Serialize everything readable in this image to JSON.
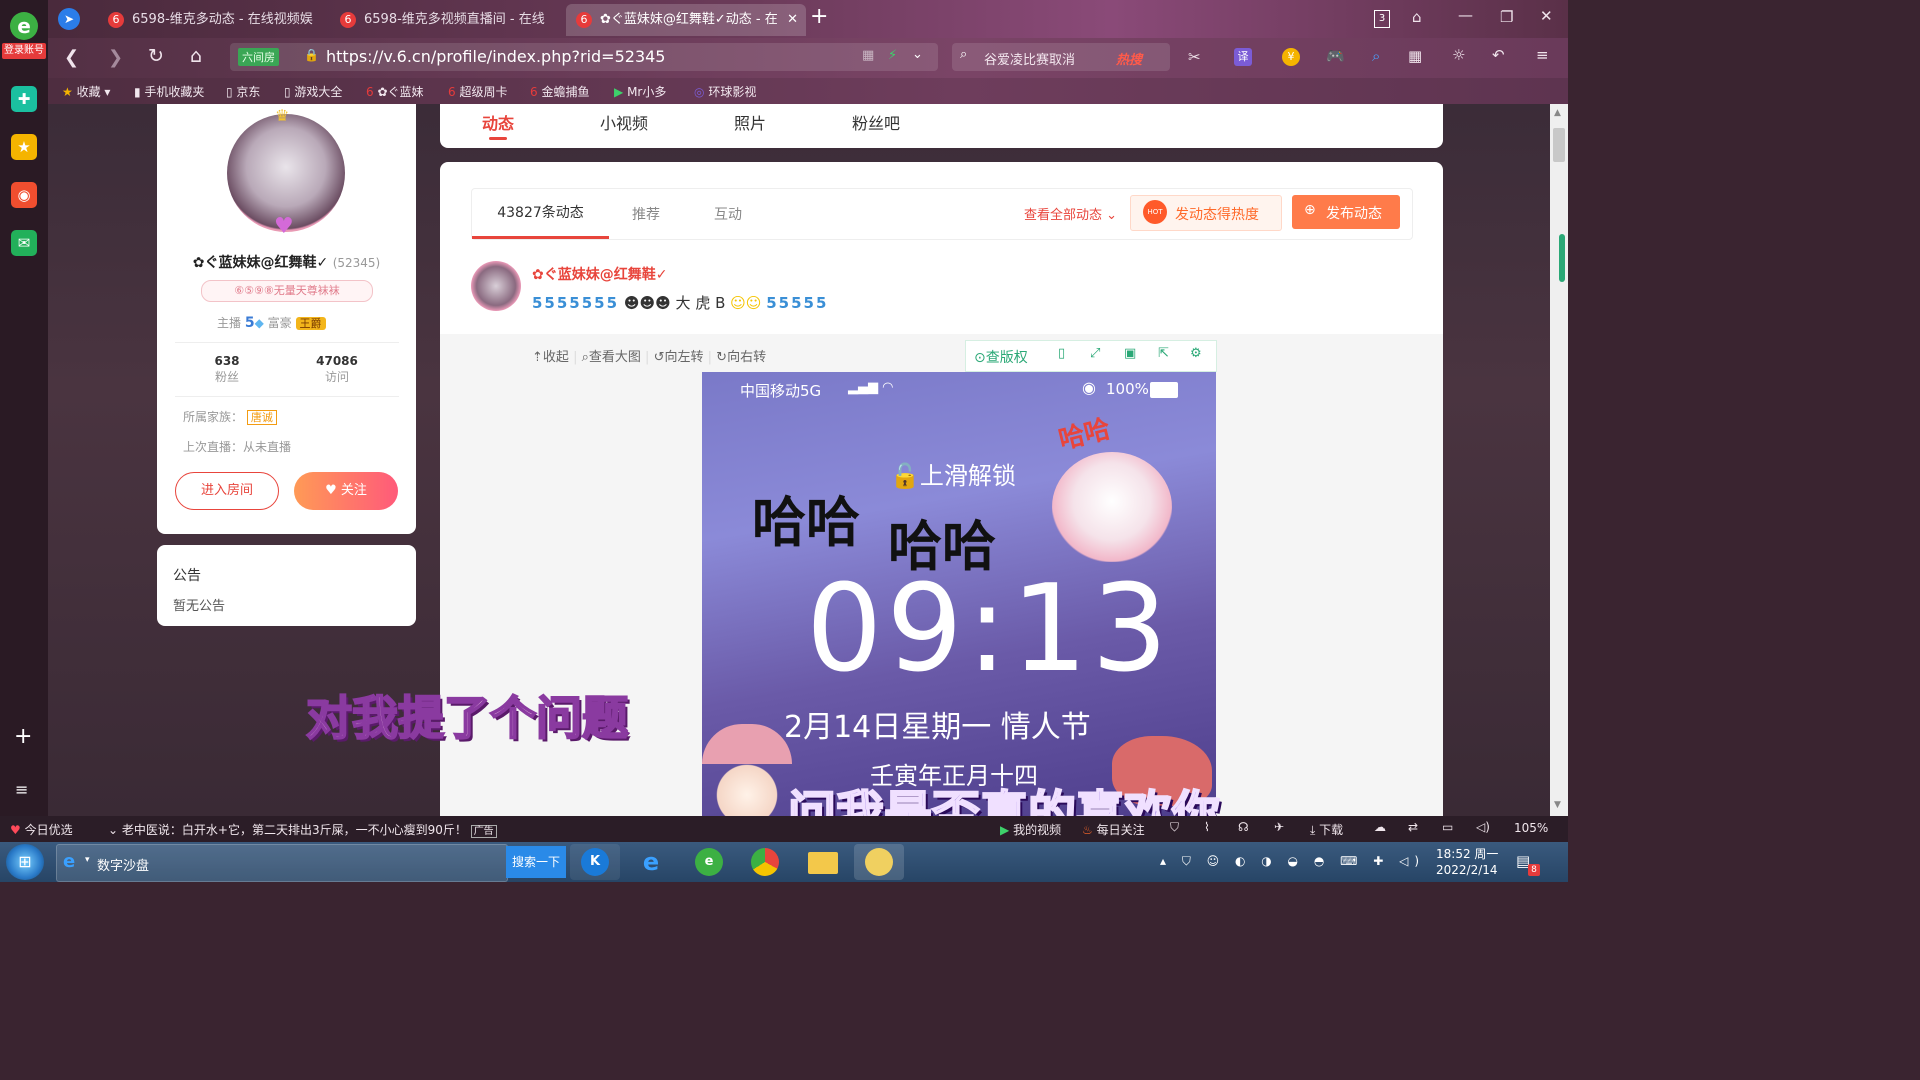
{
  "left_dock": {
    "login_label": "登录账号"
  },
  "tabs": [
    {
      "label": "6598-维克多动态 - 在线视频娱",
      "icon": "6"
    },
    {
      "label": "6598-维克多视频直播间 - 在线",
      "icon": "6"
    },
    {
      "label": "✿ぐ蓝妹妹@红舞鞋✓动态 - 在",
      "icon": "6"
    }
  ],
  "window": {
    "tab_count": "3"
  },
  "address": {
    "safe_label": "六间房",
    "url": "https://v.6.cn/profile/index.php?rid=52345",
    "search_text": "谷爱凌比赛取消",
    "hot_label": "热搜",
    "translate_label": "译"
  },
  "bookmarks": [
    {
      "label": "收藏"
    },
    {
      "label": "手机收藏夹"
    },
    {
      "label": "京东"
    },
    {
      "label": "游戏大全"
    },
    {
      "label": "ぐ蓝妹"
    },
    {
      "label": "超级周卡"
    },
    {
      "label": "金蟾捕鱼"
    },
    {
      "label": "Mr小多"
    },
    {
      "label": "环球影视"
    }
  ],
  "profile": {
    "name": "✿ぐ蓝妹妹@红舞鞋✓",
    "rid": "(52345)",
    "badge_text": "⑥⑤⑨⑧无量天尊袜袜",
    "anchor_label": "主播",
    "anchor_level": "5",
    "rich_label": "富豪",
    "rich_title": "王爵",
    "fans_value": "638",
    "fans_label": "粉丝",
    "visits_value": "47086",
    "visits_label": "访问",
    "family_label": "所属家族：",
    "family_name": "唐诚",
    "last_live_label": "上次直播：从未直播",
    "enter_room": "进入房间",
    "follow": "关注"
  },
  "notice": {
    "title": "公告",
    "content": "暂无公告"
  },
  "top_tabs": [
    "动态",
    "小视频",
    "照片",
    "粉丝吧"
  ],
  "feed": {
    "tabs": [
      "43827条动态",
      "推荐",
      "互动"
    ],
    "view_all": "查看全部动态",
    "heat_button": "发动态得热度",
    "hot_badge": "HOT",
    "publish_button": "发布动态",
    "post_author": "✿ぐ蓝妹妹@红舞鞋✓",
    "post_text": "大 虎 B",
    "emoji_row_left": "5555555",
    "emoji_row_right": "55555",
    "image_tools": [
      "收起",
      "查看大图",
      "向左转",
      "向右转"
    ],
    "copyright_label": "查版权"
  },
  "phone_image": {
    "carrier": "中国移动5G",
    "battery": "100%",
    "unlock": "上滑解锁",
    "time": "09:13",
    "date": "2月14日星期一  情人节",
    "lunar": "壬寅年正月十四",
    "haha_small": "哈哈",
    "haha_big_1": "哈哈",
    "haha_big_2": "哈哈"
  },
  "subtitles": {
    "line1": "对我提了个问题",
    "line2": "问我是否真的喜欢你"
  },
  "statusbar": {
    "daily": "今日优选",
    "news": "老中医说：白开水+它，第二天排出3斤屎，一不小心瘦到90斤！",
    "ad_tag": "广告",
    "my_video": "我的视频",
    "daily_follow": "每日关注",
    "download": "下载",
    "zoom": "105%"
  },
  "taskbar": {
    "active_window": "数字沙盘",
    "search_button": "搜索一下",
    "clock_time": "18:52 周一",
    "clock_date": "2022/2/14",
    "notify_count": "8"
  },
  "colors": {
    "accent_red": "#e8453c",
    "publish_orange": "#ff7b4a",
    "copyright_green": "#2aa876"
  }
}
